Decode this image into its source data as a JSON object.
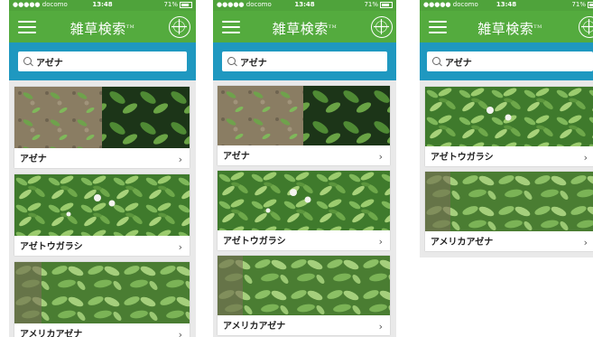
{
  "status_bar": {
    "carrier": "●●●●● docomo",
    "time": "13:48",
    "battery": "71%"
  },
  "app": {
    "title": "雑草検索",
    "title_mark": "TM"
  },
  "search": {
    "query": "アゼナ"
  },
  "screens": [
    {
      "results": [
        "アゼナ",
        "アゼトウガラシ",
        "アメリカアゼナ"
      ]
    },
    {
      "results": [
        "アゼナ",
        "アゼトウガラシ",
        "アメリカアゼナ"
      ]
    },
    {
      "results": [
        "アゼトウガラシ",
        "アメリカアゼナ"
      ]
    }
  ],
  "colors": {
    "header_green": "#54ab3e",
    "search_blue": "#1f98c0",
    "list_bg": "#e9e9e9"
  },
  "icons": {
    "menu": "hamburger-icon",
    "logo": "bayer-cross-logo",
    "search": "magnifier-icon",
    "row_arrow": "chevron-right-icon"
  }
}
